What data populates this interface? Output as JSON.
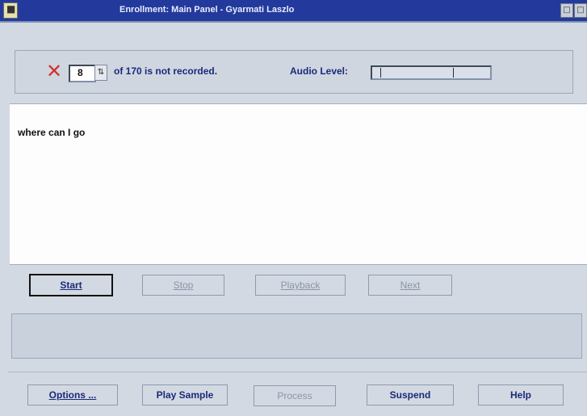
{
  "window": {
    "title": "Enrollment: Main Panel - Gyarmati Laszlo",
    "system_menu_glyph": "■",
    "buttons": [
      "□",
      "□"
    ]
  },
  "status": {
    "current_sentence": "8",
    "status_text": "of 170 is not recorded.",
    "audio_label": "Audio Level:",
    "not_recorded_icon": "x-icon",
    "accent_color": "#d2322e"
  },
  "phrase": {
    "text": "where can I go"
  },
  "controls": {
    "start": "Start",
    "stop": "Stop",
    "playback": "Playback",
    "next": "Next"
  },
  "footer": {
    "options": "Options ...",
    "play_sample": "Play Sample",
    "process": "Process",
    "suspend": "Suspend",
    "help": "Help"
  }
}
